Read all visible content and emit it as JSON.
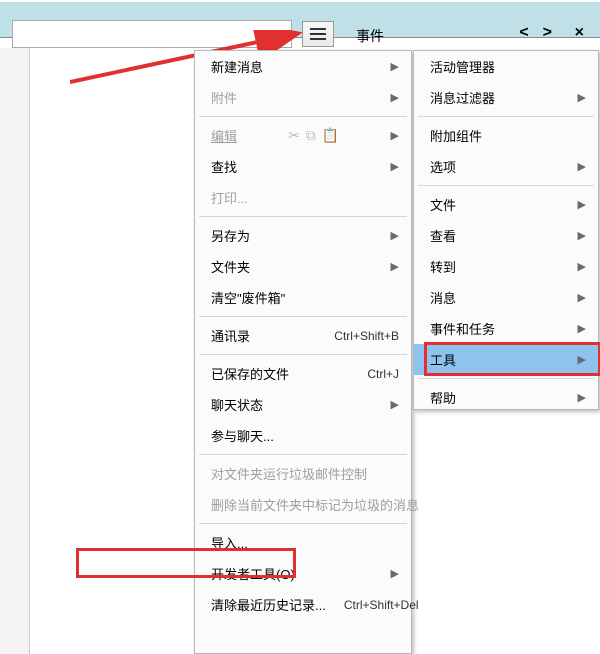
{
  "header": {
    "label": "事件",
    "nav_prev": "<",
    "nav_next": ">",
    "close": "×"
  },
  "menu1": {
    "new_message": "新建消息",
    "attachment": "附件",
    "edit": "编辑",
    "find": "查找",
    "print": "打印...",
    "save_as": "另存为",
    "folder": "文件夹",
    "empty_trash": "清空\"废件箱\"",
    "addressbook": "通讯录",
    "addressbook_sc": "Ctrl+Shift+B",
    "saved_files": "已保存的文件",
    "saved_files_sc": "Ctrl+J",
    "chat_status": "聊天状态",
    "join_chat": "参与聊天...",
    "junk_control": "对文件夹运行垃圾邮件控制",
    "delete_junk": "删除当前文件夹中标记为垃圾的消息",
    "import": "导入...",
    "dev_tools": "开发者工具(O)",
    "clear_history": "清除最近历史记录...",
    "clear_history_sc": "Ctrl+Shift+Del"
  },
  "menu2": {
    "activity_manager": "活动管理器",
    "message_filter": "消息过滤器",
    "addons": "附加组件",
    "options": "选项",
    "file": "文件",
    "view": "查看",
    "goto": "转到",
    "message": "消息",
    "events_tasks": "事件和任务",
    "tools": "工具",
    "help": "帮助"
  }
}
